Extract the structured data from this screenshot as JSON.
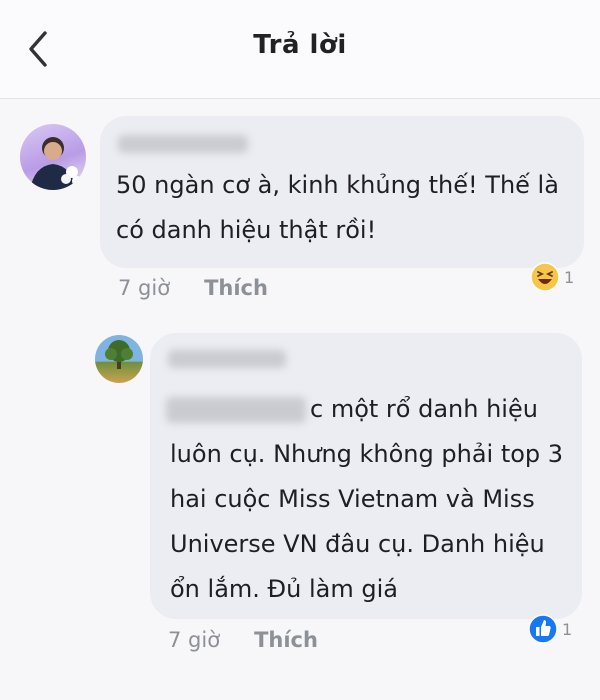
{
  "header": {
    "title": "Trả lời"
  },
  "comments": [
    {
      "text": "50 ngàn cơ à, kinh khủng thế! Thế là\ncó danh hiệu thật rồi!",
      "time": "7 giờ",
      "like_label": "Thích",
      "reaction": {
        "icon": "haha-icon",
        "count": "1"
      }
    },
    {
      "text": "c một rổ danh hiệu\nluôn cụ. Nhưng không phải top 3\nhai cuộc Miss Vietnam và Miss\nUniverse VN đâu cụ. Danh hiệu\nổn lắm. Đủ làm giá",
      "time": "7 giờ",
      "like_label": "Thích",
      "reaction": {
        "icon": "like-icon",
        "count": "1"
      }
    }
  ],
  "colors": {
    "like_blue": "#1877f2",
    "haha_yellow": "#f7c54a",
    "bubble": "#ebedf2"
  }
}
